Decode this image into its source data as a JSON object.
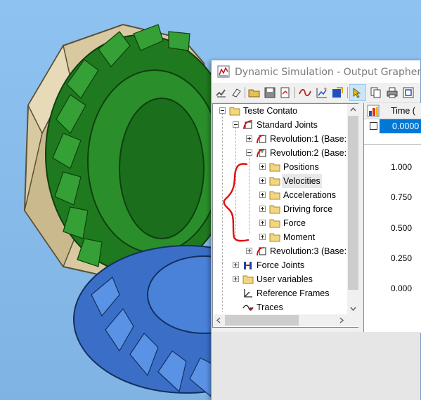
{
  "window": {
    "title": "Dynamic Simulation - Output Grapher"
  },
  "toolbar": {
    "buttons": [
      "import-icon",
      "erase-icon",
      "open-icon",
      "save-icon",
      "save-as-icon",
      "curve-icon",
      "add-variable-icon",
      "export-icon",
      "cursor-icon",
      "copy-icon",
      "print-icon",
      "zoom-icon"
    ]
  },
  "tree": {
    "root": "Teste Contato",
    "standard_joints": "Standard Joints",
    "revolution1": "Revolution:1 (Base:",
    "revolution2": "Revolution:2 (Base:",
    "positions": "Positions",
    "velocities": "Velocities",
    "accelerations": "Accelerations",
    "driving_force": "Driving force",
    "force": "Force",
    "moment": "Moment",
    "revolution3": "Revolution:3 (Base:",
    "force_joints": "Force Joints",
    "user_variables": "User variables",
    "reference_frames": "Reference Frames",
    "traces": "Traces"
  },
  "grid": {
    "time_header": "Time (",
    "time_value": "0.0000"
  },
  "graph": {
    "y_ticks": [
      "1.000",
      "0.750",
      "0.500",
      "0.250",
      "0.000"
    ]
  },
  "colors": {
    "selection": "#0078d7",
    "gear_green": "#1f7a1f",
    "gear_blue": "#3b6fc7",
    "annotation_red": "#e01010"
  }
}
